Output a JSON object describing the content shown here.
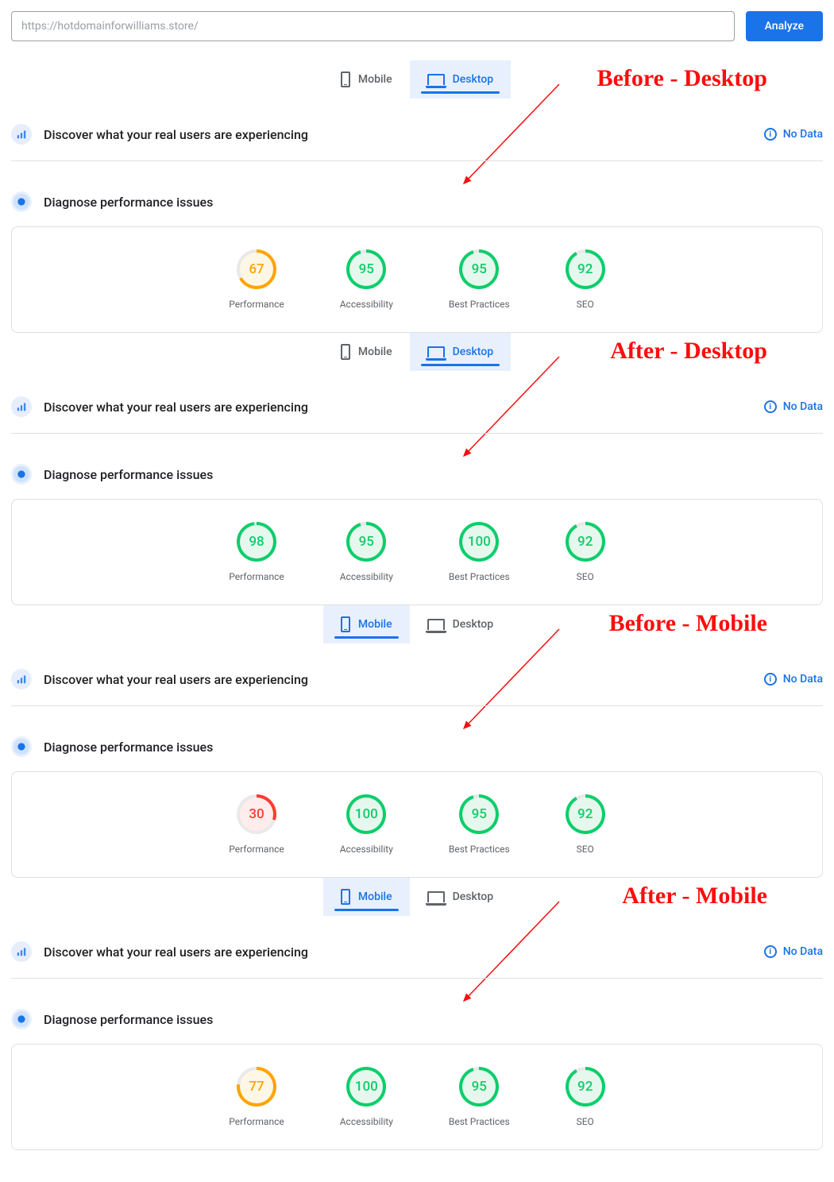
{
  "url_input_value": "https://hotdomainforwilliams.store/",
  "analyze_label": "Analyze",
  "tab_mobile": "Mobile",
  "tab_desktop": "Desktop",
  "crux_heading": "Discover what your real users are experiencing",
  "no_data": "No Data",
  "diagnose_heading": "Diagnose performance issues",
  "metric_labels": {
    "performance": "Performance",
    "accessibility": "Accessibility",
    "best_practices": "Best Practices",
    "seo": "SEO"
  },
  "annotations": {
    "before_desktop": "Before - Desktop",
    "after_desktop": "After - Desktop",
    "before_mobile": "Before - Mobile",
    "after_mobile": "After - Mobile"
  },
  "sections": [
    {
      "active_tab": "desktop",
      "scores": {
        "performance": 67,
        "accessibility": 95,
        "best_practices": 95,
        "seo": 92
      }
    },
    {
      "active_tab": "desktop",
      "scores": {
        "performance": 98,
        "accessibility": 95,
        "best_practices": 100,
        "seo": 92
      }
    },
    {
      "active_tab": "mobile",
      "scores": {
        "performance": 30,
        "accessibility": 100,
        "best_practices": 95,
        "seo": 92
      }
    },
    {
      "active_tab": "mobile",
      "scores": {
        "performance": 77,
        "accessibility": 100,
        "best_practices": 95,
        "seo": 92
      }
    }
  ],
  "colors": {
    "green": "#0cce6b",
    "orange": "#ffa400",
    "red": "#ff3b30"
  }
}
